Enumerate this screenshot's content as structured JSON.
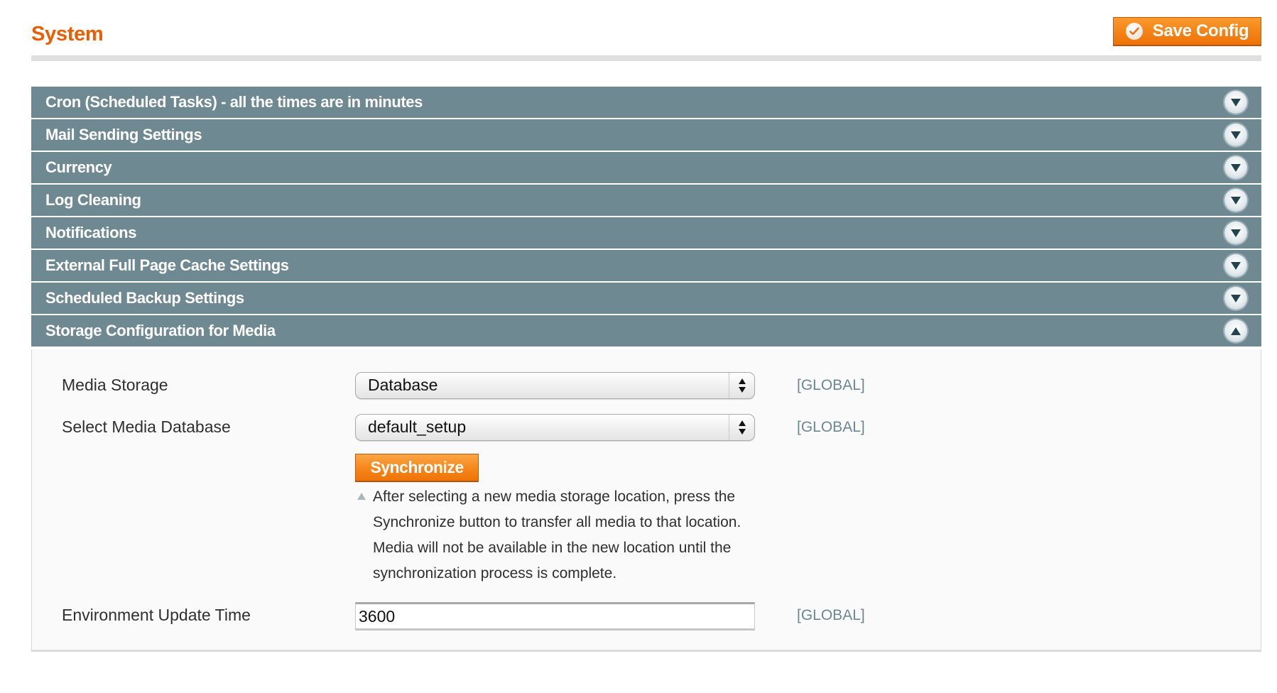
{
  "header": {
    "title": "System",
    "save_button": {
      "label": "Save Config",
      "icon": "check-circle-icon"
    }
  },
  "colors": {
    "title": "#eb5e00",
    "section_header_bg": "#6f8992",
    "button_orange": "#f58619",
    "scope_text": "#6c8791"
  },
  "sections": [
    {
      "label": "Cron (Scheduled Tasks) - all the times are in minutes",
      "expanded": false,
      "icon": "chevron-down-icon"
    },
    {
      "label": "Mail Sending Settings",
      "expanded": false,
      "icon": "chevron-down-icon"
    },
    {
      "label": "Currency",
      "expanded": false,
      "icon": "chevron-down-icon"
    },
    {
      "label": "Log Cleaning",
      "expanded": false,
      "icon": "chevron-down-icon"
    },
    {
      "label": "Notifications",
      "expanded": false,
      "icon": "chevron-down-icon"
    },
    {
      "label": "External Full Page Cache Settings",
      "expanded": false,
      "icon": "chevron-down-icon"
    },
    {
      "label": "Scheduled Backup Settings",
      "expanded": false,
      "icon": "chevron-down-icon"
    },
    {
      "label": "Storage Configuration for Media",
      "expanded": true,
      "icon": "chevron-up-icon"
    }
  ],
  "media_storage": {
    "fields": {
      "media_storage": {
        "label": "Media Storage",
        "value": "Database",
        "scope": "[GLOBAL]"
      },
      "media_database": {
        "label": "Select Media Database",
        "value": "default_setup",
        "scope": "[GLOBAL]"
      },
      "env_update_time": {
        "label": "Environment Update Time",
        "value": "3600",
        "scope": "[GLOBAL]"
      }
    },
    "synchronize_button": "Synchronize",
    "note": "After selecting a new media storage location, press the Synchronize button to transfer all media to that location. Media will not be available in the new location until the synchronization process is complete."
  }
}
